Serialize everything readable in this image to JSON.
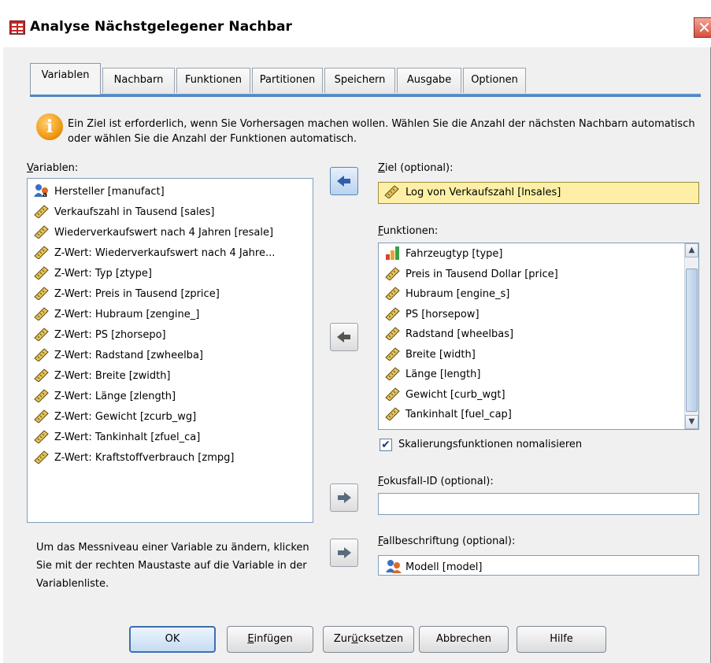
{
  "window": {
    "title": "Analyse Nächstgelegener Nachbar",
    "close_glyph": "✕"
  },
  "tabs": [
    {
      "label": "Variablen",
      "active": true
    },
    {
      "label": "Nachbarn"
    },
    {
      "label": "Funktionen"
    },
    {
      "label": "Partitionen"
    },
    {
      "label": "Speichern"
    },
    {
      "label": "Ausgabe"
    },
    {
      "label": "Optionen"
    }
  ],
  "info": {
    "icon": "info-icon",
    "glyph": "i",
    "text": "Ein Ziel ist erforderlich, wenn Sie Vorhersagen machen wollen. Wählen Sie die Anzahl der nächsten Nachbarn automatisch oder wählen Sie die Anzahl der Funktionen automatisch."
  },
  "variables": {
    "label_key": "V",
    "label_rest": "ariablen:",
    "items": [
      {
        "label": "Hersteller [manufact]",
        "icon": "nominal-icon"
      },
      {
        "label": "Verkaufszahl in Tausend [sales]",
        "icon": "scale-ruler-icon"
      },
      {
        "label": "Wiederverkaufswert nach 4 Jahren [resale]",
        "icon": "scale-ruler-icon"
      },
      {
        "label": "Z-Wert:  Wiederverkaufswert nach 4 Jahre...",
        "icon": "scale-ruler-icon"
      },
      {
        "label": "Z-Wert: Typ [ztype]",
        "icon": "scale-ruler-icon"
      },
      {
        "label": "Z-Wert: Preis in Tausend [zprice]",
        "icon": "scale-ruler-icon"
      },
      {
        "label": "Z-Wert: Hubraum [zengine_]",
        "icon": "scale-ruler-icon"
      },
      {
        "label": "Z-Wert: PS [zhorsepo]",
        "icon": "scale-ruler-icon"
      },
      {
        "label": "Z-Wert: Radstand [zwheelba]",
        "icon": "scale-ruler-icon"
      },
      {
        "label": "Z-Wert: Breite [zwidth]",
        "icon": "scale-ruler-icon"
      },
      {
        "label": "Z-Wert: Länge [zlength]",
        "icon": "scale-ruler-icon"
      },
      {
        "label": "Z-Wert: Gewicht [zcurb_wg]",
        "icon": "scale-ruler-icon"
      },
      {
        "label": "Z-Wert: Tankinhalt [zfuel_ca]",
        "icon": "scale-ruler-icon"
      },
      {
        "label": "Z-Wert: Kraftstoffverbrauch [zmpg]",
        "icon": "scale-ruler-icon"
      }
    ]
  },
  "target": {
    "label_key": "Z",
    "label_rest": "iel (optional):",
    "value": "Log von Verkaufszahl [lnsales]",
    "icon": "scale-ruler-icon"
  },
  "features": {
    "label_key": "F",
    "label_rest": "unktionen:",
    "items": [
      {
        "label": "Fahrzeugtyp [type]",
        "icon": "ordinal-bars-icon"
      },
      {
        "label": "Preis in Tausend Dollar [price]",
        "icon": "scale-ruler-icon"
      },
      {
        "label": "Hubraum [engine_s]",
        "icon": "scale-ruler-icon"
      },
      {
        "label": "PS [horsepow]",
        "icon": "scale-ruler-icon"
      },
      {
        "label": "Radstand [wheelbas]",
        "icon": "scale-ruler-icon"
      },
      {
        "label": "Breite [width]",
        "icon": "scale-ruler-icon"
      },
      {
        "label": "Länge [length]",
        "icon": "scale-ruler-icon"
      },
      {
        "label": "Gewicht [curb_wgt]",
        "icon": "scale-ruler-icon"
      },
      {
        "label": "Tankinhalt [fuel_cap]",
        "icon": "scale-ruler-icon"
      }
    ],
    "scroll_position": 0.78
  },
  "normalize": {
    "checked": true,
    "check_glyph": "✔",
    "label": "Skalierungsfunktionen nomalisieren"
  },
  "focus_case": {
    "label_key": "F",
    "label_rest": "okusfall-ID (optional):",
    "value": ""
  },
  "case_label": {
    "label_key": "F",
    "label_rest": "allbeschriftung (optional):",
    "value": "Modell [model]",
    "icon": "nominal-icon"
  },
  "hint": "Um das Messniveau einer Variable zu ändern, klicken Sie mit der rechten Maustaste auf die Variable in der Variablenliste.",
  "buttons": {
    "ok": "OK",
    "paste_key": "E",
    "paste_rest": "infügen",
    "reset_pre": "Zur",
    "reset_key": "ü",
    "reset_rest": "cksetzen",
    "cancel": "Abbrechen",
    "help": "Hilfe"
  }
}
